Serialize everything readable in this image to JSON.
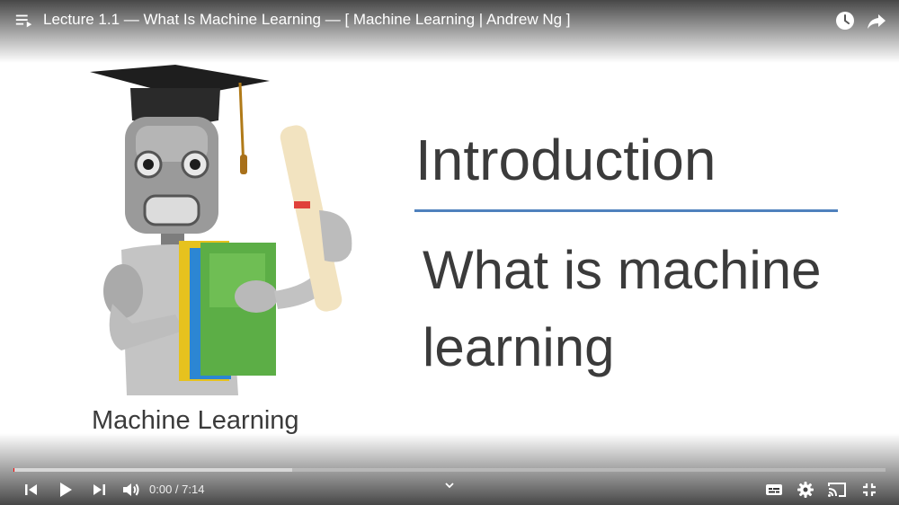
{
  "player": {
    "title": "Lecture 1.1 — What Is Machine Learning — [ Machine Learning | Andrew Ng ]",
    "time": {
      "current": "0:00",
      "separator": " / ",
      "duration": "7:14"
    },
    "progress": {
      "played_fraction": 0.0,
      "buffered_fraction": 0.32
    }
  },
  "slide": {
    "heading": "Introduction",
    "subheading": "What is machine learning",
    "caption": "Machine Learning"
  },
  "icons": {
    "playlist": "playlist-icon",
    "watch_later": "clock-icon",
    "share": "share-arrow-icon",
    "previous": "skip-previous-icon",
    "play": "play-icon",
    "next": "skip-next-icon",
    "volume": "volume-icon",
    "expand": "chevron-down-icon",
    "subtitles": "subtitles-icon",
    "settings": "gear-icon",
    "cast": "cast-icon",
    "exit_fullscreen": "exit-fullscreen-icon"
  },
  "colors": {
    "accent_rule": "#4f81bd",
    "progress_played": "#ff0000",
    "slide_text": "#3b3b3b"
  }
}
